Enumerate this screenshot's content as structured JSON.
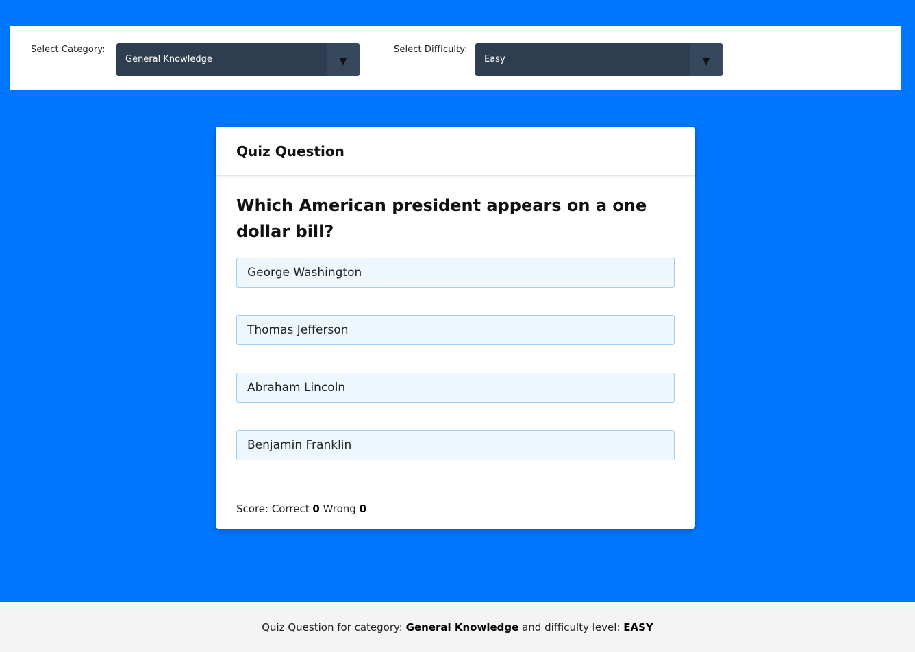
{
  "filters": {
    "category_label": "Select Category:",
    "category_value": "General Knowledge",
    "difficulty_label": "Select Difficulty:",
    "difficulty_value": "Easy",
    "arrow_icon": "chevron-down-icon"
  },
  "card": {
    "title": "Quiz Question",
    "question": "Which American president appears on a one dollar bill?",
    "answers": [
      "George Washington",
      "Thomas Jefferson",
      "Abraham Lincoln",
      "Benjamin Franklin"
    ],
    "score": {
      "prefix": "Score: Correct",
      "correct": "0",
      "wrong_label": "Wrong",
      "wrong": "0"
    }
  },
  "footer": {
    "prefix": "Quiz Question for category:",
    "category": "General Knowledge",
    "middle": "and difficulty level:",
    "difficulty": "EASY"
  },
  "colors": {
    "background": "#0077ff",
    "select_bg": "#2e3d50",
    "answer_bg": "#eef6fe",
    "answer_border": "#9fd0ee"
  }
}
